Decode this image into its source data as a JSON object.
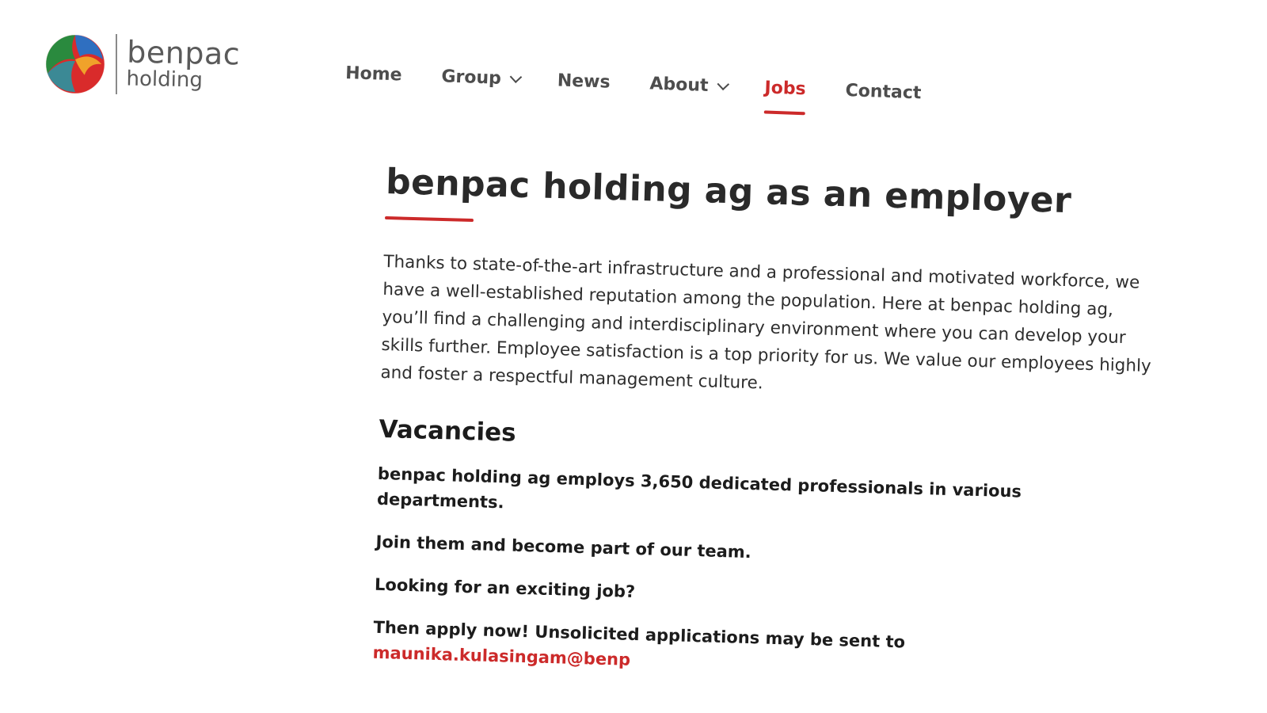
{
  "logo": {
    "word1": "benpac",
    "word2": "holding"
  },
  "nav": {
    "items": [
      {
        "label": "Home"
      },
      {
        "label": "Group"
      },
      {
        "label": "News"
      },
      {
        "label": "About"
      },
      {
        "label": "Jobs"
      },
      {
        "label": "Contact"
      }
    ],
    "active": "Jobs"
  },
  "main": {
    "title": "benpac holding ag as an employer",
    "intro": "Thanks to state-of-the-art infrastructure and a professional and motivated workforce, we have a well-established reputation among the population. Here at benpac holding ag, you’ll find a challenging and interdisciplinary environment where you can develop your skills further. Employee satisfaction is a top priority for us. We value our employees highly and foster a respectful management culture.",
    "vacancies_title": "Vacancies",
    "p1": "benpac holding ag employs 3,650 dedicated professionals in various departments.",
    "p2": "Join them and become part of our team.",
    "p3": "Looking for an exciting job?",
    "p4_prefix": "Then apply now! Unsolicited applications may be sent to",
    "email_visible": "maunika.kulasingam@benp"
  },
  "colors": {
    "accent": "#cc2a2a",
    "text": "#2f2f2f",
    "nav_text": "#4d4d4d",
    "background": "#ffffff"
  }
}
